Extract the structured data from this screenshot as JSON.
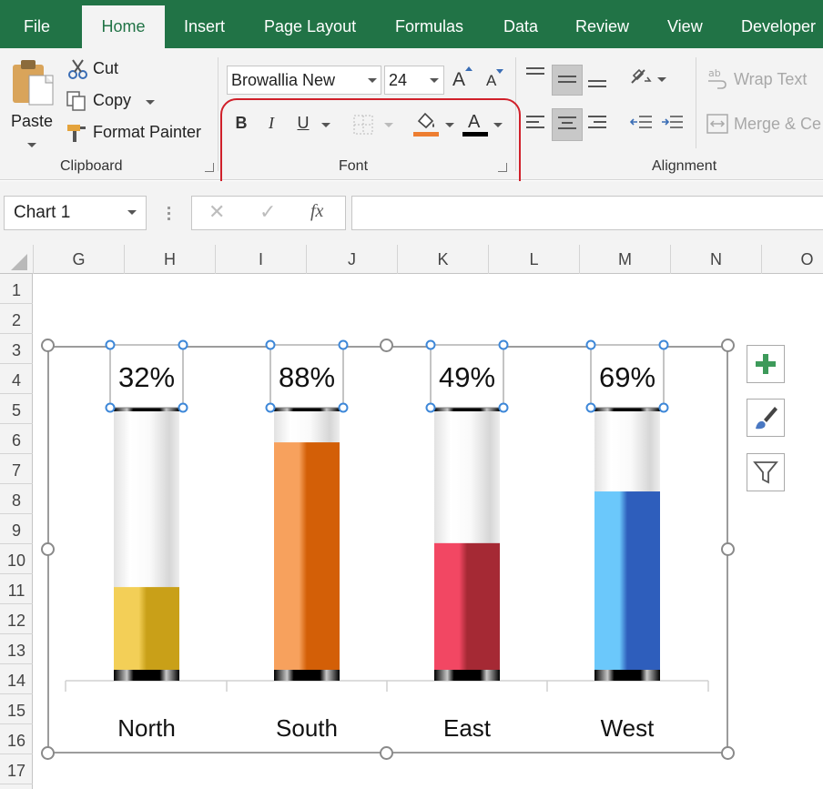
{
  "tabs": [
    {
      "label": "File",
      "active": false
    },
    {
      "label": "Home",
      "active": true
    },
    {
      "label": "Insert",
      "active": false
    },
    {
      "label": "Page Layout",
      "active": false
    },
    {
      "label": "Formulas",
      "active": false
    },
    {
      "label": "Data",
      "active": false
    },
    {
      "label": "Review",
      "active": false
    },
    {
      "label": "View",
      "active": false
    },
    {
      "label": "Developer",
      "active": false
    }
  ],
  "clipboard": {
    "group_label": "Clipboard",
    "paste_label": "Paste",
    "cut_label": "Cut",
    "copy_label": "Copy",
    "format_painter_label": "Format Painter"
  },
  "font": {
    "group_label": "Font",
    "font_name": "Browallia New",
    "font_size": "24",
    "bold": "B",
    "italic": "I",
    "underline": "U",
    "font_color_letter": "A",
    "grow_letter": "A",
    "shrink_letter": "A",
    "fill_color": "#ed7d31",
    "font_color": "#000000"
  },
  "alignment": {
    "group_label": "Alignment",
    "wrap_text_label": "Wrap Text",
    "merge_label": "Merge & Ce"
  },
  "formula_bar": {
    "name_box": "Chart 1",
    "fx_label": "fx",
    "formula": ""
  },
  "columns": [
    "G",
    "H",
    "I",
    "J",
    "K",
    "L",
    "M",
    "N",
    "O"
  ],
  "rows": [
    "1",
    "2",
    "3",
    "4",
    "5",
    "6",
    "7",
    "8",
    "9",
    "10",
    "11",
    "12",
    "13",
    "14",
    "15",
    "16",
    "17"
  ],
  "chart_data": {
    "type": "bar",
    "categories": [
      "North",
      "South",
      "East",
      "West"
    ],
    "values": [
      32,
      88,
      49,
      69
    ],
    "value_labels": [
      "32%",
      "88%",
      "49%",
      "69%"
    ],
    "ylim": [
      0,
      100
    ],
    "title": "",
    "xlabel": "",
    "ylabel": "",
    "grid": false,
    "colors": [
      {
        "light": "#f3cf57",
        "dark": "#c9a018"
      },
      {
        "light": "#f7a15d",
        "dark": "#d35f07"
      },
      {
        "light": "#f24763",
        "dark": "#a52934"
      },
      {
        "light": "#6bc8fb",
        "dark": "#2e5ebc"
      }
    ]
  },
  "chart_tools": [
    {
      "name": "chart-elements-button",
      "icon": "plus-icon"
    },
    {
      "name": "chart-styles-button",
      "icon": "paintbrush-icon"
    },
    {
      "name": "chart-filters-button",
      "icon": "funnel-icon"
    }
  ]
}
